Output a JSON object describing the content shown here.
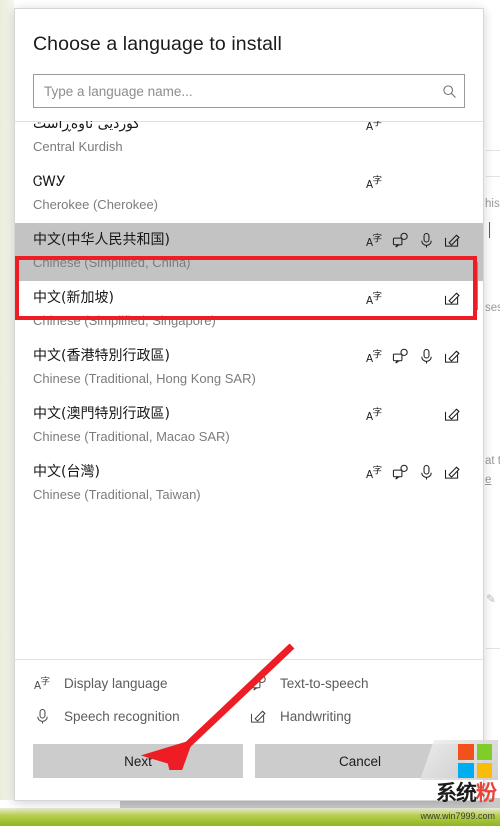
{
  "dialog": {
    "title": "Choose a language to install",
    "search": {
      "placeholder": "Type a language name...",
      "value": "",
      "icon": "search-icon"
    },
    "languages": [
      {
        "native": "کوردیی ناوەڕاست",
        "english": "Central Kurdish",
        "features": [
          "display-language"
        ],
        "selected": false,
        "partial_top": true
      },
      {
        "native": "ᏣᎳᎩ",
        "english": "Cherokee (Cherokee)",
        "features": [
          "display-language"
        ],
        "selected": false
      },
      {
        "native": "中文(中华人民共和国)",
        "english": "Chinese (Simplified, China)",
        "features": [
          "display-language",
          "text-to-speech",
          "speech-recognition",
          "handwriting"
        ],
        "selected": true
      },
      {
        "native": "中文(新加坡)",
        "english": "Chinese (Simplified, Singapore)",
        "features": [
          "display-language",
          "handwriting"
        ],
        "selected": false
      },
      {
        "native": "中文(香港特別行政區)",
        "english": "Chinese (Traditional, Hong Kong SAR)",
        "features": [
          "display-language",
          "text-to-speech",
          "speech-recognition",
          "handwriting"
        ],
        "selected": false
      },
      {
        "native": "中文(澳門特別行政區)",
        "english": "Chinese (Traditional, Macao SAR)",
        "features": [
          "display-language",
          "handwriting"
        ],
        "selected": false
      },
      {
        "native": "中文(台灣)",
        "english": "Chinese (Traditional, Taiwan)",
        "features": [
          "display-language",
          "text-to-speech",
          "speech-recognition",
          "handwriting"
        ],
        "selected": false
      }
    ],
    "legend": [
      {
        "icon": "display-language",
        "label": "Display language"
      },
      {
        "icon": "text-to-speech",
        "label": "Text-to-speech"
      },
      {
        "icon": "speech-recognition",
        "label": "Speech recognition"
      },
      {
        "icon": "handwriting",
        "label": "Handwriting"
      }
    ],
    "buttons": {
      "next": "Next",
      "cancel": "Cancel"
    }
  },
  "background_text": {
    "fragment_1": "his",
    "fragment_2": "ses",
    "fragment_3": "at t",
    "fragment_4": "e"
  },
  "annotations": {
    "highlight_color": "#ee1c25",
    "arrow_color": "#ee1c25",
    "highlight_target": "中文(中华人民共和国)",
    "arrow_target": "Next"
  },
  "watermark": {
    "brand_left": "系统",
    "brand_accent": "粉",
    "url": "www.win7999.com",
    "square_colors": [
      "#f1511b",
      "#80cc28",
      "#00adef",
      "#fbbc09"
    ]
  }
}
